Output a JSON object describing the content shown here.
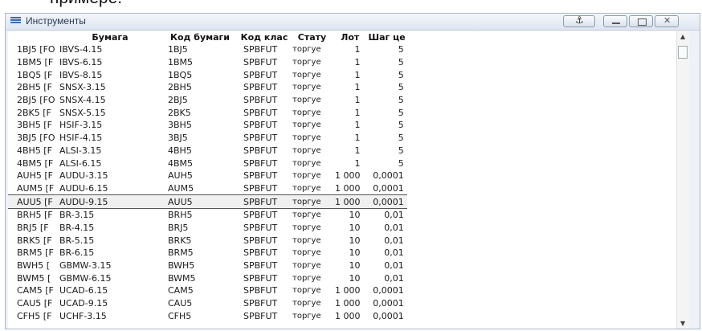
{
  "header_text": "примере.",
  "window": {
    "title": "Инструменты",
    "anchor_glyph": "⚓"
  },
  "table": {
    "columns": [
      "",
      "Бумага",
      "Код бумаги",
      "Код клас",
      "Стату",
      "Лот",
      "Шаг це"
    ],
    "rows": [
      [
        "1BJ5 [FO",
        "IBVS-4.15",
        "1BJ5",
        "SPBFUT",
        "торгуе",
        "1",
        "5"
      ],
      [
        "1BM5 [F",
        "IBVS-6.15",
        "1BM5",
        "SPBFUT",
        "торгуе",
        "1",
        "5"
      ],
      [
        "1BQ5 [F",
        "IBVS-8.15",
        "1BQ5",
        "SPBFUT",
        "торгуе",
        "1",
        "5"
      ],
      [
        "2BH5 [F",
        "SNSX-3.15",
        "2BH5",
        "SPBFUT",
        "торгуе",
        "1",
        "5"
      ],
      [
        "2BJ5 [FO",
        "SNSX-4.15",
        "2BJ5",
        "SPBFUT",
        "торгуе",
        "1",
        "5"
      ],
      [
        "2BK5 [F",
        "SNSX-5.15",
        "2BK5",
        "SPBFUT",
        "торгуе",
        "1",
        "5"
      ],
      [
        "3BH5 [F",
        "HSIF-3.15",
        "3BH5",
        "SPBFUT",
        "торгуе",
        "1",
        "5"
      ],
      [
        "3BJ5 [FO",
        "HSIF-4.15",
        "3BJ5",
        "SPBFUT",
        "торгуе",
        "1",
        "5"
      ],
      [
        "4BH5 [F",
        "ALSI-3.15",
        "4BH5",
        "SPBFUT",
        "торгуе",
        "1",
        "5"
      ],
      [
        "4BM5 [F",
        "ALSI-6.15",
        "4BM5",
        "SPBFUT",
        "торгуе",
        "1",
        "5"
      ],
      [
        "AUH5 [F",
        "AUDU-3.15",
        "AUH5",
        "SPBFUT",
        "торгуе",
        "1 000",
        "0,0001"
      ],
      [
        "AUM5 [F",
        "AUDU-6.15",
        "AUM5",
        "SPBFUT",
        "торгуе",
        "1 000",
        "0,0001"
      ],
      [
        "AUU5 [F",
        "AUDU-9.15",
        "AUU5",
        "SPBFUT",
        "торгуе",
        "1 000",
        "0,0001"
      ],
      [
        "BRH5 [F",
        "BR-3.15",
        "BRH5",
        "SPBFUT",
        "торгуе",
        "10",
        "0,01"
      ],
      [
        "BRJ5 [F",
        "BR-4.15",
        "BRJ5",
        "SPBFUT",
        "торгуе",
        "10",
        "0,01"
      ],
      [
        "BRK5 [F",
        "BR-5.15",
        "BRK5",
        "SPBFUT",
        "торгуе",
        "10",
        "0,01"
      ],
      [
        "BRM5 [F",
        "BR-6.15",
        "BRM5",
        "SPBFUT",
        "торгуе",
        "10",
        "0,01"
      ],
      [
        "BWH5 [",
        "GBMW-3.15",
        "BWH5",
        "SPBFUT",
        "торгуе",
        "10",
        "0,01"
      ],
      [
        "BWM5 [",
        "GBMW-6.15",
        "BWM5",
        "SPBFUT",
        "торгуе",
        "10",
        "0,01"
      ],
      [
        "CAM5 [F",
        "UCAD-6.15",
        "CAM5",
        "SPBFUT",
        "торгуе",
        "1 000",
        "0,0001"
      ],
      [
        "CAU5 [F",
        "UCAD-9.15",
        "CAU5",
        "SPBFUT",
        "торгуе",
        "1 000",
        "0,0001"
      ],
      [
        "CFH5 [F",
        "UCHF-3.15",
        "CFH5",
        "SPBFUT",
        "торгуе",
        "1 000",
        "0,0001"
      ]
    ],
    "selected_row": 12
  },
  "scrollbar": {
    "up_glyph": "▲",
    "down_glyph": "▼"
  },
  "icons": {
    "window_icon": "list-icon",
    "anchor": "anchor-icon",
    "minimize": "minimize-icon",
    "maximize": "maximize-icon",
    "close": "close-icon"
  }
}
